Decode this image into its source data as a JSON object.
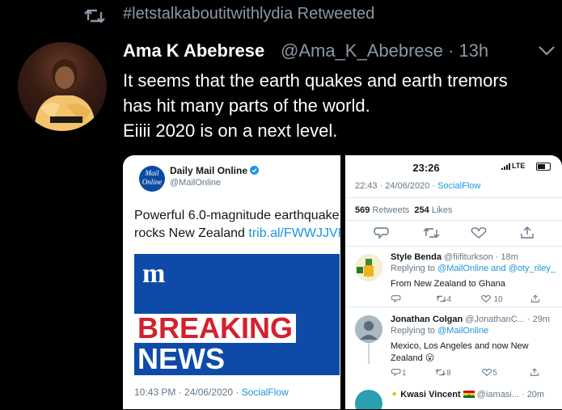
{
  "retweet": {
    "text": "#letstalkaboutitwithlydia Retweeted"
  },
  "tweet": {
    "author_name": "Ama K Abebrese",
    "author_meta": "@Ama_K_Abebrese · 13h",
    "lines": [
      "It seems that the earth quakes and earth tremors",
      "has hit many parts of the world.",
      "Eiiii 2020 is on a next level."
    ]
  },
  "card_left": {
    "logo_top": "Mail",
    "logo_bottom": "Online",
    "name": "Daily Mail Online",
    "handle": "@MailOnline",
    "text_line1": "Powerful 6.0-magnitude earthquake",
    "text_line2": "rocks New Zealand",
    "link": "trib.al/FWWJJVR",
    "image_logo": "m",
    "breaking": "BREAKING",
    "news": "NEWS",
    "footer_time": "10:43 PM · 24/06/2020 · ",
    "footer_source": "SocialFlow"
  },
  "card_right": {
    "status_time": "23:26",
    "status_lte": "LTE",
    "date": "22:43 · 24/06/2020 · ",
    "date_source": "SocialFlow",
    "retweets_count": "569",
    "retweets_label": "Retweets",
    "likes_count": "254",
    "likes_label": "Likes",
    "replies": [
      {
        "name": "Style Benda",
        "meta": "@fiifiturkson · 18m",
        "replying_prefix": "Replying to ",
        "replying_to": "@MailOnline and @oty_riley_",
        "body1": "From New Zealand to Ghana",
        "body2": "",
        "retweets": "4",
        "likes": "10"
      },
      {
        "name": "Jonathan Colgan",
        "meta": "@JonathanC... · 29m",
        "replying_prefix": "Replying to ",
        "replying_to": "@MailOnline",
        "body1": "Mexico, Los Angeles and now New",
        "body2": "Zealand 😮",
        "replies": "1",
        "retweets": "8",
        "likes": "5"
      },
      {
        "name": "Kwasi Vincent",
        "meta": "@iamasi... · 20m"
      }
    ]
  },
  "colors": {
    "accent": "#1b95e0",
    "muted": "#8b98a5",
    "daily_mail_blue": "#0e4ba8",
    "breaking_red": "#d4202e"
  }
}
